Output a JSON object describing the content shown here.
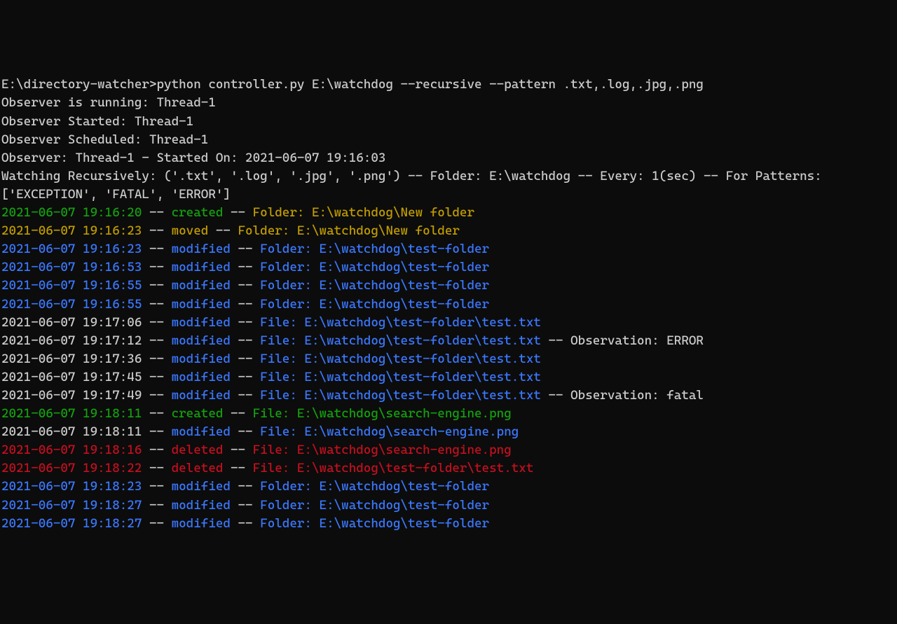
{
  "prompt": "E:\\directory-watcher>python controller.py E:\\watchdog --recursive --pattern .txt,.log,.jpg,.png",
  "startup": [
    "Observer is running: Thread-1",
    "Observer Started: Thread-1",
    "Observer Scheduled: Thread-1",
    "Observer: Thread-1 - Started On: 2021-06-07 19:16:03",
    "Watching Recursively: ('.txt', '.log', '.jpg', '.png') -- Folder: E:\\watchdog -- Every: 1(sec) -- For Patterns: ['EXCEPTION', 'FATAL', 'ERROR']"
  ],
  "events": [
    {
      "ts": "2021-06-07 19:16:20",
      "sep1": " -- ",
      "action": "created",
      "sep2": " -- ",
      "target": "Folder: E:\\watchdog\\New folder",
      "extra": "",
      "scheme": "created-folder"
    },
    {
      "ts": "2021-06-07 19:16:23",
      "sep1": " -- ",
      "action": "moved",
      "sep2": " -- ",
      "target": "Folder: E:\\watchdog\\New folder",
      "extra": "",
      "scheme": "moved-folder"
    },
    {
      "ts": "2021-06-07 19:16:23",
      "sep1": " -- ",
      "action": "modified",
      "sep2": " -- ",
      "target": "Folder: E:\\watchdog\\test-folder",
      "extra": "",
      "scheme": "modified-folder"
    },
    {
      "ts": "2021-06-07 19:16:53",
      "sep1": " -- ",
      "action": "modified",
      "sep2": " -- ",
      "target": "Folder: E:\\watchdog\\test-folder",
      "extra": "",
      "scheme": "modified-folder"
    },
    {
      "ts": "2021-06-07 19:16:55",
      "sep1": " -- ",
      "action": "modified",
      "sep2": " -- ",
      "target": "Folder: E:\\watchdog\\test-folder",
      "extra": "",
      "scheme": "modified-folder"
    },
    {
      "ts": "2021-06-07 19:16:55",
      "sep1": " -- ",
      "action": "modified",
      "sep2": " -- ",
      "target": "Folder: E:\\watchdog\\test-folder",
      "extra": "",
      "scheme": "modified-folder"
    },
    {
      "ts": "2021-06-07 19:17:06",
      "sep1": " -- ",
      "action": "modified",
      "sep2": " -- ",
      "target": "File: E:\\watchdog\\test-folder\\test.txt",
      "extra": "",
      "scheme": "modified-file"
    },
    {
      "ts": "2021-06-07 19:17:12",
      "sep1": " -- ",
      "action": "modified",
      "sep2": " -- ",
      "target": "File: E:\\watchdog\\test-folder\\test.txt",
      "extra": " -- Observation: ERROR",
      "scheme": "modified-file"
    },
    {
      "ts": "2021-06-07 19:17:36",
      "sep1": " -- ",
      "action": "modified",
      "sep2": " -- ",
      "target": "File: E:\\watchdog\\test-folder\\test.txt",
      "extra": "",
      "scheme": "modified-file"
    },
    {
      "ts": "2021-06-07 19:17:45",
      "sep1": " -- ",
      "action": "modified",
      "sep2": " -- ",
      "target": "File: E:\\watchdog\\test-folder\\test.txt",
      "extra": "",
      "scheme": "modified-file"
    },
    {
      "ts": "2021-06-07 19:17:49",
      "sep1": " -- ",
      "action": "modified",
      "sep2": " -- ",
      "target": "File: E:\\watchdog\\test-folder\\test.txt",
      "extra": " -- Observation: fatal",
      "scheme": "modified-file"
    },
    {
      "ts": "2021-06-07 19:18:11",
      "sep1": " -- ",
      "action": "created",
      "sep2": " -- ",
      "target": "File: E:\\watchdog\\search-engine.png",
      "extra": "",
      "scheme": "created-file"
    },
    {
      "ts": "2021-06-07 19:18:11",
      "sep1": " -- ",
      "action": "modified",
      "sep2": " -- ",
      "target": "File: E:\\watchdog\\search-engine.png",
      "extra": "",
      "scheme": "modified-file-alt"
    },
    {
      "ts": "2021-06-07 19:18:16",
      "sep1": " -- ",
      "action": "deleted",
      "sep2": " -- ",
      "target": "File: E:\\watchdog\\search-engine.png",
      "extra": "",
      "scheme": "deleted-file"
    },
    {
      "ts": "2021-06-07 19:18:22",
      "sep1": " -- ",
      "action": "deleted",
      "sep2": " -- ",
      "target": "File: E:\\watchdog\\test-folder\\test.txt",
      "extra": "",
      "scheme": "deleted-file"
    },
    {
      "ts": "2021-06-07 19:18:23",
      "sep1": " -- ",
      "action": "modified",
      "sep2": " -- ",
      "target": "Folder: E:\\watchdog\\test-folder",
      "extra": "",
      "scheme": "modified-folder"
    },
    {
      "ts": "2021-06-07 19:18:27",
      "sep1": " -- ",
      "action": "modified",
      "sep2": " -- ",
      "target": "Folder: E:\\watchdog\\test-folder",
      "extra": "",
      "scheme": "modified-folder"
    },
    {
      "ts": "2021-06-07 19:18:27",
      "sep1": " -- ",
      "action": "modified",
      "sep2": " -- ",
      "target": "Folder: E:\\watchdog\\test-folder",
      "extra": "",
      "scheme": "modified-folder"
    }
  ],
  "schemes": {
    "created-folder": {
      "ts": "green",
      "sep1": "white",
      "action": "green",
      "sep2": "white",
      "target": "yellow",
      "extra": "white"
    },
    "moved-folder": {
      "ts": "darkyellow",
      "sep1": "white",
      "action": "darkyellow",
      "sep2": "white",
      "target": "yellow",
      "extra": "white"
    },
    "modified-folder": {
      "ts": "blue",
      "sep1": "white",
      "action": "blue",
      "sep2": "white",
      "target": "blue",
      "extra": "white"
    },
    "modified-file": {
      "ts": "white",
      "sep1": "white",
      "action": "blue",
      "sep2": "white",
      "target": "blue",
      "extra": "white"
    },
    "modified-file-alt": {
      "ts": "white",
      "sep1": "white",
      "action": "blue",
      "sep2": "white",
      "target": "blue",
      "extra": "white"
    },
    "created-file": {
      "ts": "green",
      "sep1": "white",
      "action": "green",
      "sep2": "white",
      "target": "green",
      "extra": "white"
    },
    "deleted-file": {
      "ts": "red",
      "sep1": "white",
      "action": "red",
      "sep2": "white",
      "target": "red",
      "extra": "white"
    }
  }
}
